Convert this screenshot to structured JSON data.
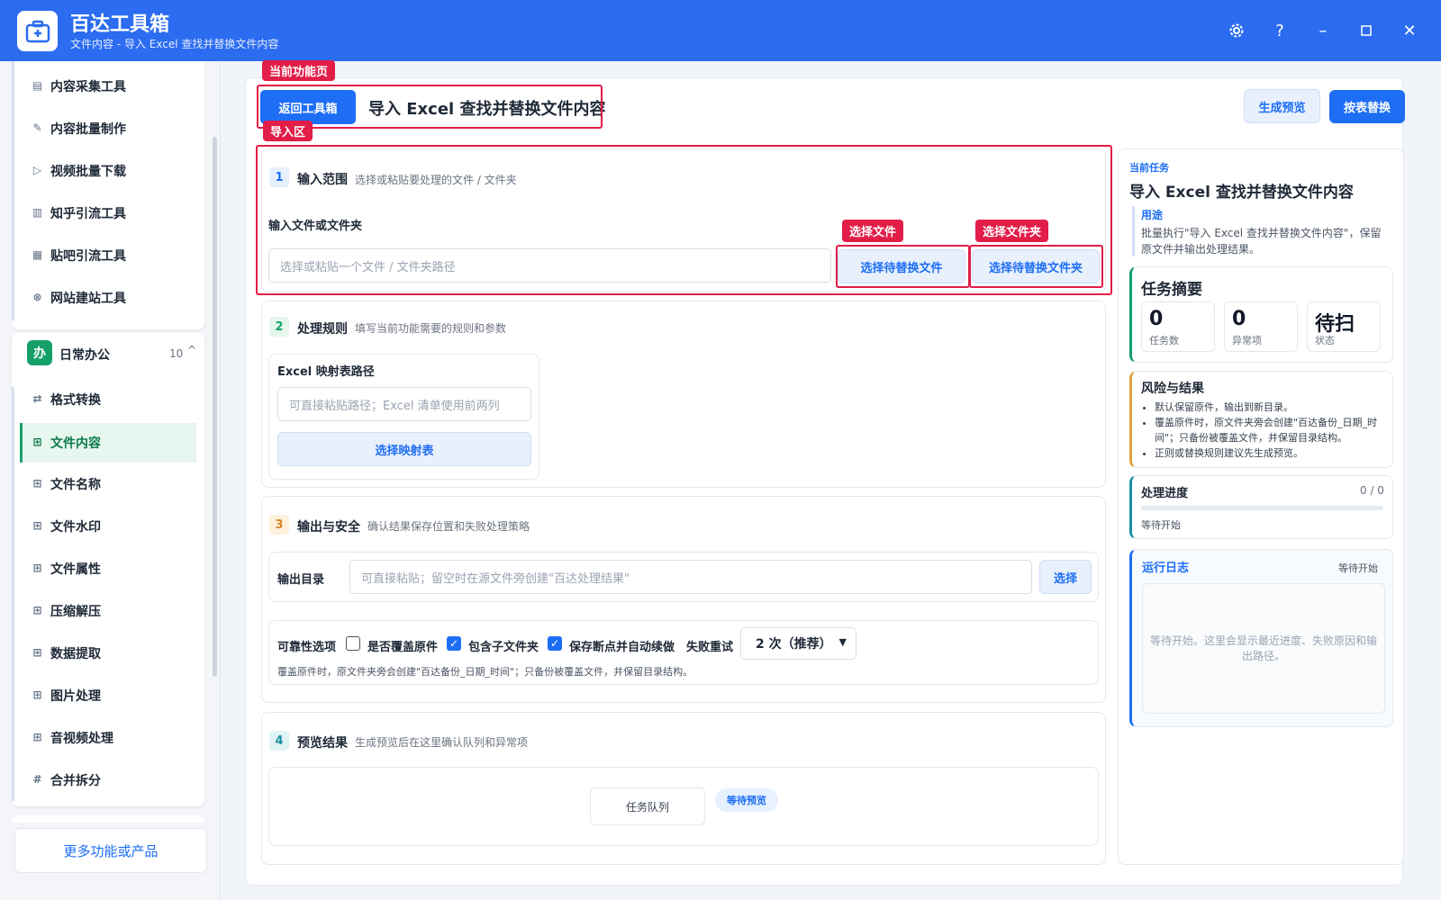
{
  "app": {
    "name": "百达工具箱",
    "subtitle": "文件内容 - 导入 Excel 查找并替换文件内容"
  },
  "sidebar": {
    "group1_items": [
      {
        "label": "内容采集工具",
        "icon": "document-icon"
      },
      {
        "label": "内容批量制作",
        "icon": "pen-icon"
      },
      {
        "label": "视频批量下载",
        "icon": "video-icon"
      },
      {
        "label": "知乎引流工具",
        "icon": "book-icon"
      },
      {
        "label": "贴吧引流工具",
        "icon": "post-icon"
      },
      {
        "label": "网站建站工具",
        "icon": "web-icon"
      }
    ],
    "group2": {
      "badge": "办",
      "title": "日常办公",
      "count": "10",
      "toggle": "^"
    },
    "group2_items": [
      {
        "label": "格式转换",
        "icon": "swap-icon"
      },
      {
        "label": "文件内容",
        "icon": "grid-icon"
      },
      {
        "label": "文件名称",
        "icon": "grid-icon"
      },
      {
        "label": "文件水印",
        "icon": "grid-icon"
      },
      {
        "label": "文件属性",
        "icon": "grid-icon"
      },
      {
        "label": "压缩解压",
        "icon": "grid-icon"
      },
      {
        "label": "数据提取",
        "icon": "grid-icon"
      },
      {
        "label": "图片处理",
        "icon": "grid-icon"
      },
      {
        "label": "音视频处理",
        "icon": "grid-icon"
      },
      {
        "label": "合并拆分",
        "icon": "hash-icon"
      }
    ],
    "more": "更多功能或产品"
  },
  "header": {
    "back": "返回工具箱",
    "title": "导入 Excel 查找并替换文件内容",
    "preview_btn": "生成预览",
    "run_btn": "按表替换"
  },
  "tags": {
    "current_page": "当前功能页",
    "import_area": "导入区",
    "select_file": "选择文件",
    "select_folder": "选择文件夹"
  },
  "section1": {
    "num": "1",
    "title": "输入范围",
    "desc": "选择或粘贴要处理的文件 / 文件夹",
    "field_label": "输入文件或文件夹",
    "placeholder": "选择或粘贴一个文件 / 文件夹路径",
    "btn_file": "选择待替换文件",
    "btn_folder": "选择待替换文件夹"
  },
  "section2": {
    "num": "2",
    "title": "处理规则",
    "desc": "填写当前功能需要的规则和参数",
    "field_label": "Excel 映射表路径",
    "placeholder": "可直接粘贴路径；Excel 清单使用前两列",
    "btn": "选择映射表"
  },
  "section3": {
    "num": "3",
    "title": "输出与安全",
    "desc": "确认结果保存位置和失败处理策略",
    "out_label": "输出目录",
    "out_placeholder": "可直接粘贴；留空时在源文件旁创建\"百达处理结果\"",
    "out_btn": "选择",
    "rel_label": "可靠性选项",
    "opt1": "是否覆盖原件",
    "opt2": "包含子文件夹",
    "opt3": "保存断点并自动续做",
    "retry_label": "失败重试",
    "retry_value": "2 次（推荐）",
    "note": "覆盖原件时，原文件夹旁会创建\"百达备份_日期_时间\"；只备份被覆盖文件，并保留目录结构。"
  },
  "section4": {
    "num": "4",
    "title": "预览结果",
    "desc": "生成预览后在这里确认队列和异常项",
    "queue": "任务队列",
    "status": "等待预览"
  },
  "right": {
    "current_label": "当前任务",
    "task_title": "导入 Excel 查找并替换文件内容",
    "purpose_label": "用途",
    "purpose_text": "批量执行\"导入 Excel 查找并替换文件内容\"，保留原文件并输出处理结果。",
    "summary_title": "任务摘要",
    "stats": [
      {
        "value": "0",
        "label": "任务数"
      },
      {
        "value": "0",
        "label": "异常项"
      },
      {
        "value": "待扫",
        "label": "状态"
      }
    ],
    "risk_title": "风险与结果",
    "risk_items": [
      "默认保留原件，输出到新目录。",
      "覆盖原件时，原文件夹旁会创建\"百达备份_日期_时间\"；只备份被覆盖文件，并保留目录结构。",
      "正则或替换规则建议先生成预览。"
    ],
    "progress_title": "处理进度",
    "progress_count": "0 / 0",
    "progress_value": 0,
    "progress_status": "等待开始",
    "log_title": "运行日志",
    "log_status": "等待开始",
    "log_text": "等待开始。这里会显示最近进度、失败原因和输出路径。"
  }
}
